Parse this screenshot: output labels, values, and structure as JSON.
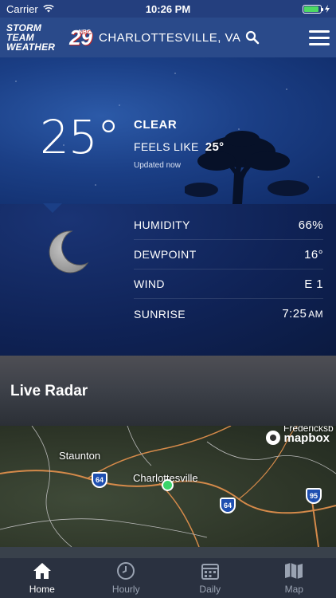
{
  "statusbar": {
    "carrier": "Carrier",
    "time": "10:26 PM",
    "battery_level": 0.9
  },
  "header": {
    "logo_line1": "STORM TEAM",
    "logo_line2": "WEATHER",
    "logo_number": "29",
    "logo_network": "NBC",
    "location": "CHARLOTTESVILLE, VA"
  },
  "current": {
    "temperature": "25°",
    "condition": "CLEAR",
    "feels_like_label": "FEELS LIKE",
    "feels_like_value": "25°",
    "updated": "Updated now"
  },
  "details": [
    {
      "label": "HUMIDITY",
      "value": "66%"
    },
    {
      "label": "DEWPOINT",
      "value": "16°"
    },
    {
      "label": "WIND",
      "value": "E 1"
    },
    {
      "label": "SUNRISE",
      "value": "7:25",
      "suffix": "AM"
    }
  ],
  "radar": {
    "title": "Live Radar",
    "attribution": "mapbox",
    "labels": {
      "city_main": "Charlottesville",
      "city_west": "Staunton",
      "city_ne": "Fredericksb"
    },
    "highways": [
      "64",
      "64",
      "95"
    ]
  },
  "tabs": [
    {
      "label": "Home",
      "icon": "home-icon",
      "active": true
    },
    {
      "label": "Hourly",
      "icon": "clock-icon",
      "active": false
    },
    {
      "label": "Daily",
      "icon": "calendar-icon",
      "active": false
    },
    {
      "label": "Map",
      "icon": "map-icon",
      "active": false
    }
  ]
}
